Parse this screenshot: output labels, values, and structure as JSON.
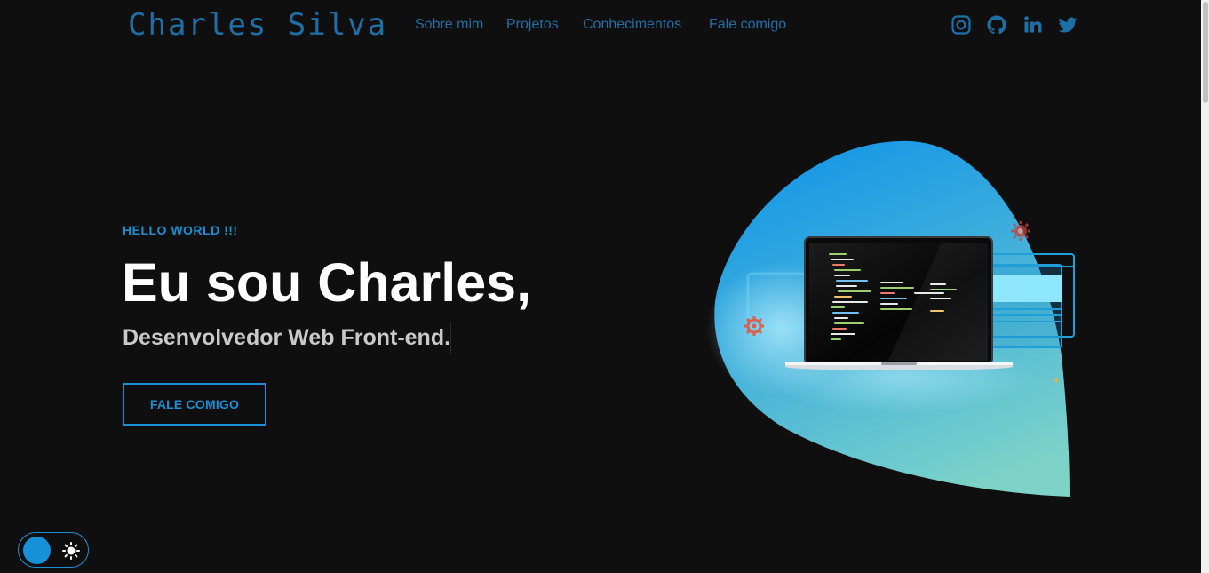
{
  "header": {
    "logo": "Charles Silva",
    "nav": [
      "Sobre mim",
      "Projetos",
      "Conhecimentos",
      "Fale comigo"
    ],
    "social": [
      "instagram-icon",
      "github-icon",
      "linkedin-icon",
      "twitter-icon"
    ]
  },
  "hero": {
    "eyebrow": "HELLO WORLD !!!",
    "title": "Eu sou Charles,",
    "subtitle": "Desenvolvedor Web Front-end.",
    "cta_label": "FALE COMIGO"
  },
  "theme_toggle": {
    "icon": "sun-icon"
  },
  "colors": {
    "background": "#0f0f0f",
    "accent": "#1b8fd6",
    "logo": "#1d6fa7",
    "text": "#ffffff",
    "subtitle": "#c9c9c9"
  }
}
